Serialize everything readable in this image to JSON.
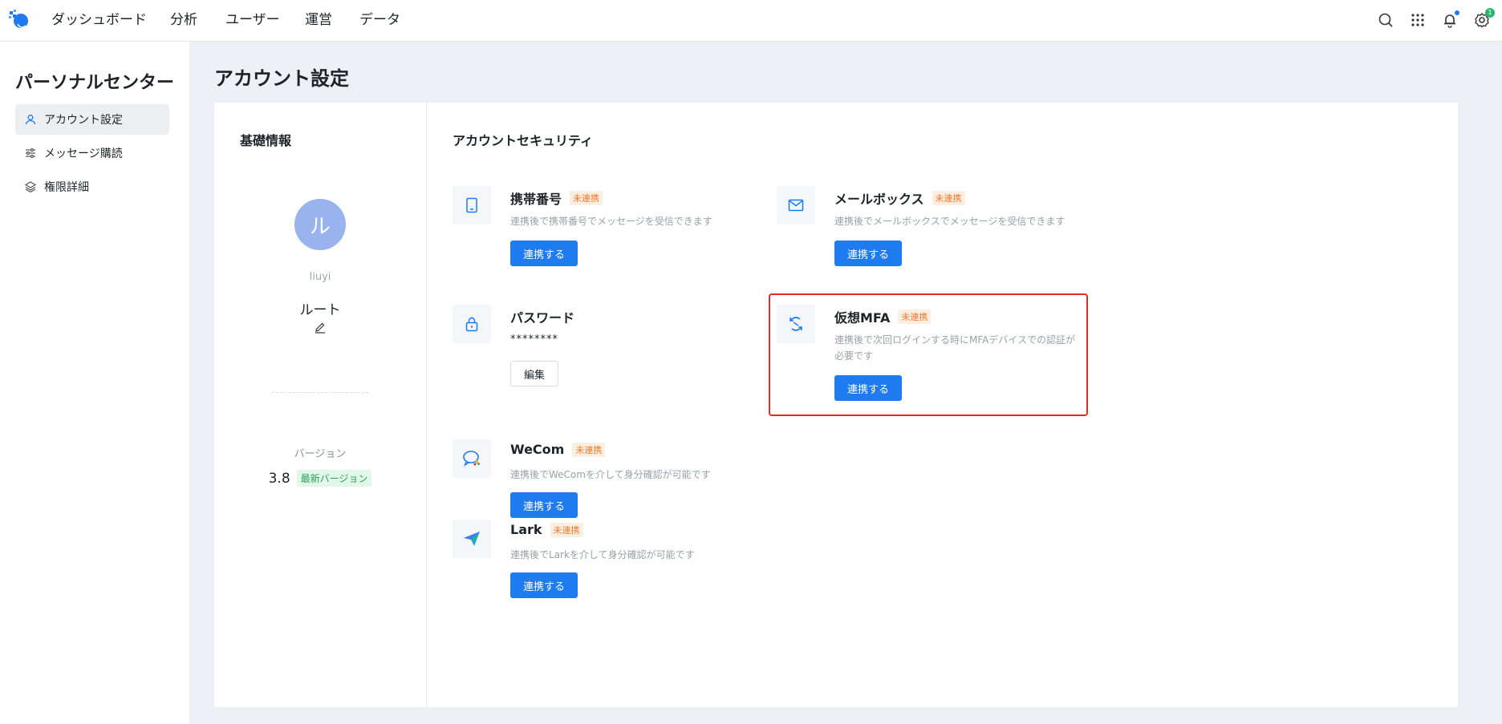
{
  "nav": {
    "items": [
      "ダッシュボード",
      "分析",
      "ユーザー",
      "運営",
      "データ"
    ],
    "settings_badge": "1"
  },
  "sidebar": {
    "title": "パーソナルセンター",
    "items": [
      {
        "label": "アカウント設定",
        "icon": "user-icon",
        "active": true
      },
      {
        "label": "メッセージ購読",
        "icon": "sliders-icon",
        "active": false
      },
      {
        "label": "権限詳細",
        "icon": "layers-icon",
        "active": false
      }
    ]
  },
  "page": {
    "title": "アカウント設定"
  },
  "basic": {
    "title": "基礎情報",
    "avatar_char": "ル",
    "username": "liuyi",
    "role": "ルート",
    "version_label": "バージョン",
    "version": "3.8",
    "version_badge": "最新バージョン"
  },
  "security": {
    "title": "アカウントセキュリティ",
    "items": [
      {
        "name": "携帯番号",
        "tag": "未連携",
        "desc": "連携後で携帯番号でメッセージを受信できます",
        "button": "連携する",
        "icon": "phone-icon"
      },
      {
        "name": "メールボックス",
        "tag": "未連携",
        "desc": "連携後でメールボックスでメッセージを受信できます",
        "button": "連携する",
        "icon": "mail-icon"
      },
      {
        "name": "パスワード",
        "mask": "********",
        "button": "編集",
        "icon": "lock-icon"
      },
      {
        "name": "仮想MFA",
        "tag": "未連携",
        "desc1": "連携後で次回ログインする時にMFAデバイスでの認証が",
        "desc2": "必要です",
        "button": "連携する",
        "icon": "mfa-icon"
      },
      {
        "name": "WeCom",
        "tag": "未連携",
        "desc": "連携後でWeComを介して身分確認が可能です",
        "button": "連携する",
        "icon": "wecom-icon"
      },
      {
        "name": "Lark",
        "tag": "未連携",
        "desc": "連携後でLarkを介して身分確認が可能です",
        "button": "連携する",
        "icon": "lark-icon"
      }
    ]
  },
  "colors": {
    "primary": "#1e7bf0",
    "tag": "#f07a2e",
    "highlight": "#e8272a"
  }
}
